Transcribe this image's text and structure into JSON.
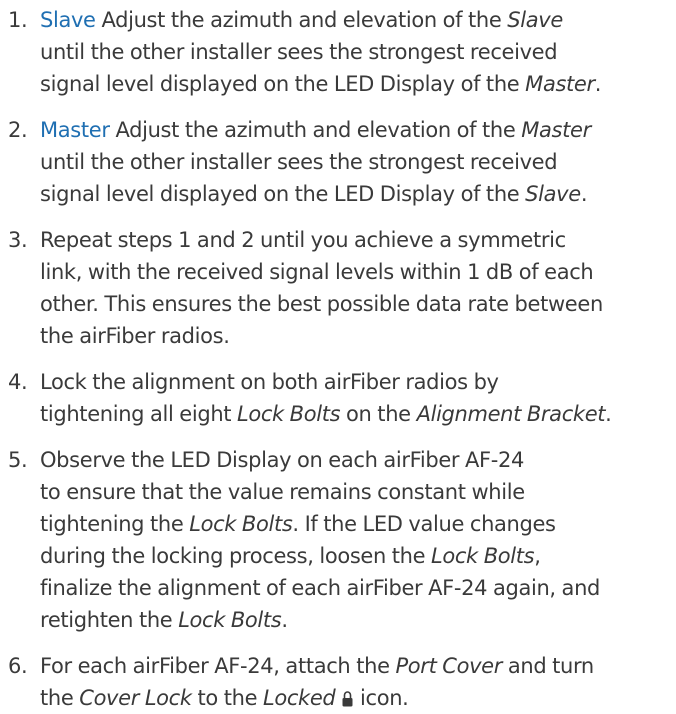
{
  "steps": [
    {
      "number": "1.",
      "tag": "Slave",
      "lines": [
        {
          "a": "Adjust the azimuth and elevation of the ",
          "i": "Slave"
        },
        {
          "a": "until the other installer sees the strongest received"
        },
        {
          "a": "signal level displayed on the LED Display of the ",
          "i": "Master",
          "b": "."
        }
      ]
    },
    {
      "number": "2.",
      "tag": "Master",
      "lines": [
        {
          "a": "Adjust the azimuth and elevation of the ",
          "i": "Master"
        },
        {
          "a": "until the other installer sees the strongest received"
        },
        {
          "a": "signal level displayed on the LED Display of the ",
          "i": "Slave",
          "b": "."
        }
      ]
    },
    {
      "number": "3.",
      "lines": [
        {
          "a": "Repeat steps 1 and 2 until you achieve a symmetric"
        },
        {
          "a": "link, with the received signal levels within 1 dB of each"
        },
        {
          "a": "other. This ensures the best possible data rate between"
        },
        {
          "a": "the airFiber radios."
        }
      ]
    },
    {
      "number": "4.",
      "lines": [
        {
          "a": "Lock the alignment on both airFiber radios by"
        },
        {
          "a": "tightening all eight ",
          "i": "Lock Bolts",
          "b": " on the ",
          "i2": "Alignment Bracket",
          "c": "."
        }
      ]
    },
    {
      "number": "5.",
      "lines": [
        {
          "a": "Observe the LED Display on each airFiber AF-24"
        },
        {
          "a": "to ensure that the value remains constant while"
        },
        {
          "a": "tightening the ",
          "i": "Lock Bolts",
          "b": ". If the LED value changes"
        },
        {
          "a": "during the locking process, loosen the ",
          "i": "Lock Bolts",
          "b": ","
        },
        {
          "a": "finalize the alignment of each airFiber AF-24 again, and"
        },
        {
          "a": "retighten the ",
          "i": "Lock Bolts",
          "b": "."
        }
      ]
    },
    {
      "number": "6.",
      "lines": [
        {
          "a": "For each airFiber AF-24, attach the ",
          "i": "Port Cover",
          "b": " and turn"
        },
        {
          "a": "the ",
          "i": "Cover Lock",
          "b": " to the ",
          "i2": "Locked",
          "icon": "lock-icon",
          "c": " icon."
        }
      ]
    }
  ]
}
